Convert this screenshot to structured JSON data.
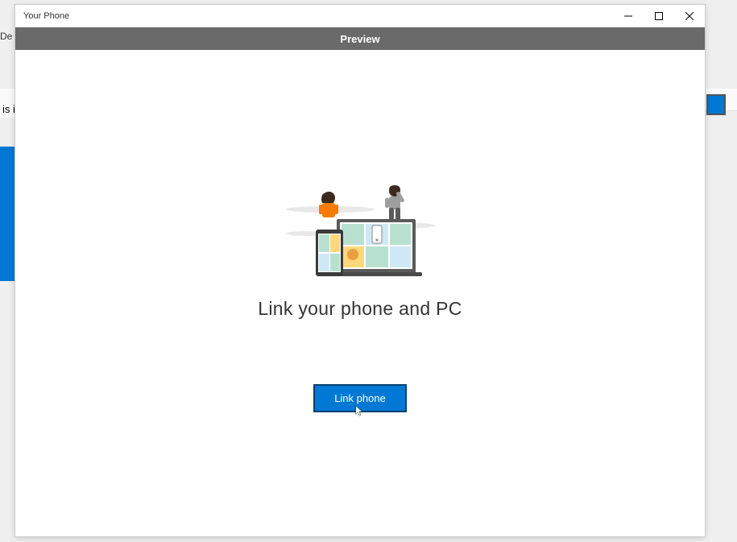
{
  "window": {
    "title": "Your Phone"
  },
  "preview_bar": {
    "label": "Preview"
  },
  "main": {
    "heading": "Link your phone and PC",
    "button_label": "Link phone"
  },
  "background": {
    "text_de": "De",
    "text_is": "is i"
  },
  "colors": {
    "accent": "#0078d4",
    "preview_bg": "#6a6a6a"
  }
}
